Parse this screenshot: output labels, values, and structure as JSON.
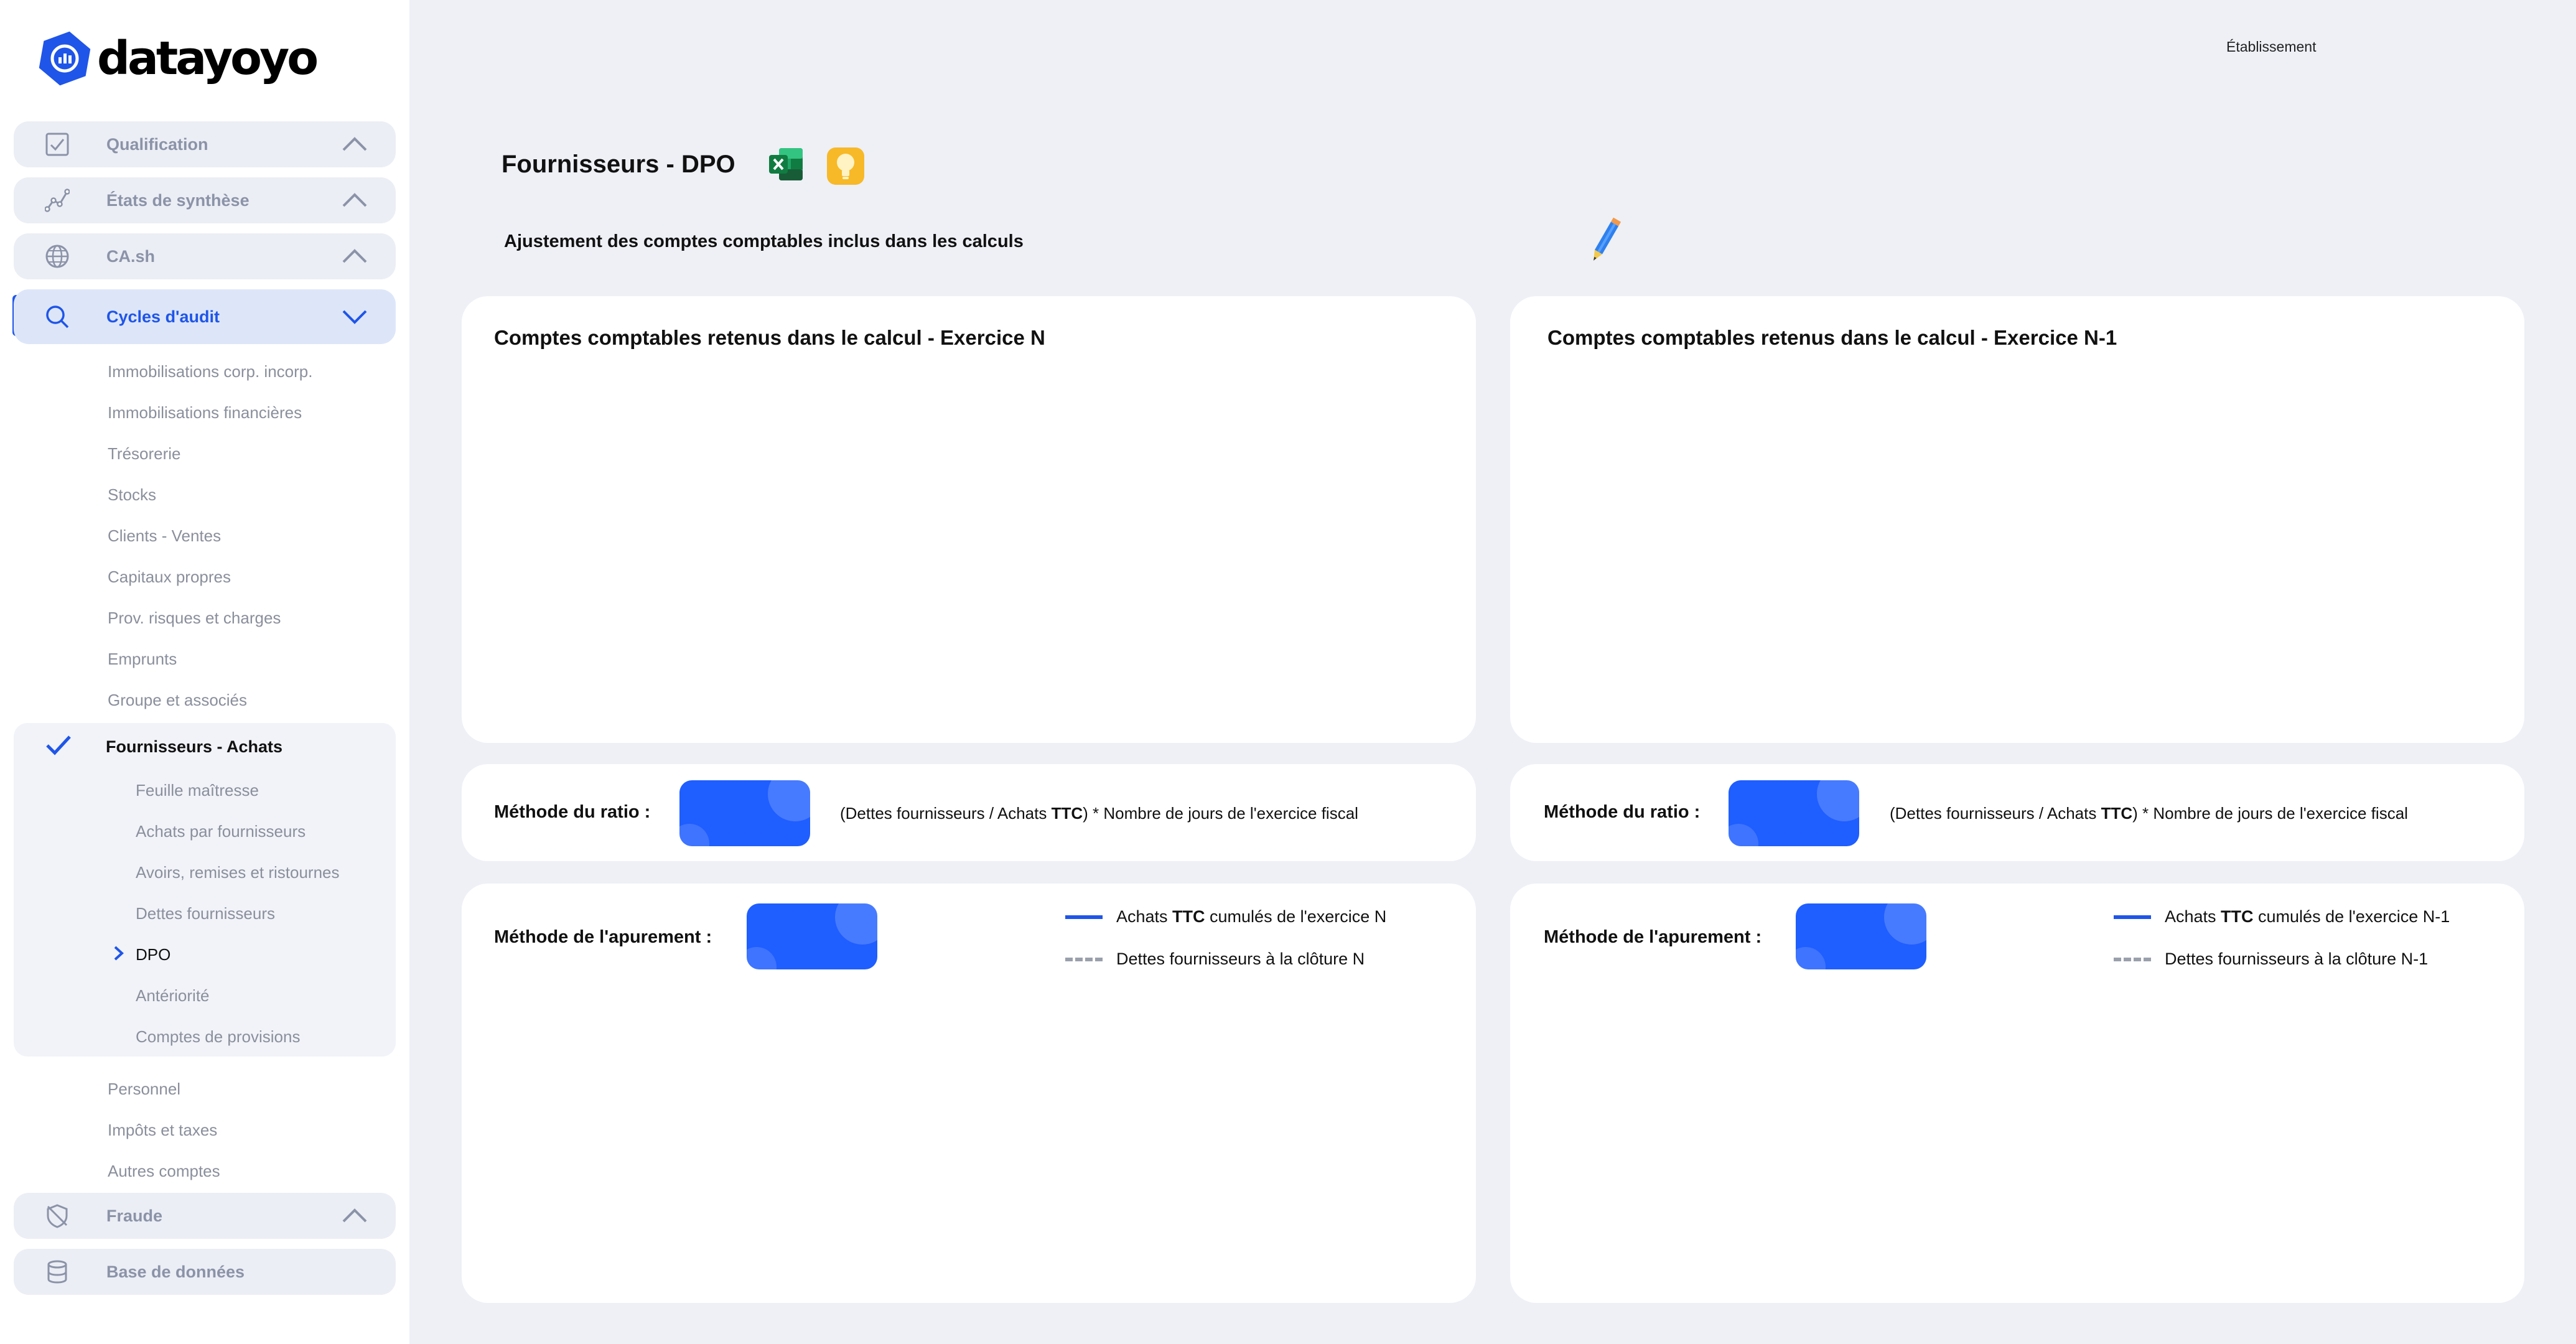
{
  "brand": {
    "name": "datayoyo",
    "color": "#1f55e8"
  },
  "sidebar": {
    "top_items": [
      {
        "label": "Qualification",
        "icon": "checkbox-icon"
      },
      {
        "label": "États de synthèse",
        "icon": "line-chart-icon"
      },
      {
        "label": "CA.sh",
        "icon": "globe-icon"
      }
    ],
    "active_item": {
      "label": "Cycles d'audit",
      "icon": "search-icon"
    },
    "cycles": [
      "Immobilisations corp. incorp.",
      "Immobilisations financières",
      "Trésorerie",
      "Stocks",
      "Clients - Ventes",
      "Capitaux propres",
      "Prov. risques et charges",
      "Emprunts",
      "Groupe et associés"
    ],
    "group": {
      "title": "Fournisseurs - Achats",
      "items": [
        "Feuille maîtresse",
        "Achats par fournisseurs",
        "Avoirs, remises et ristournes",
        "Dettes fournisseurs",
        "DPO",
        "Antériorité",
        "Comptes de provisions"
      ]
    },
    "after_group": [
      "Personnel",
      "Impôts et taxes",
      "Autres comptes"
    ],
    "bottom_items": [
      {
        "label": "Fraude",
        "icon": "shield-off-icon"
      },
      {
        "label": "Base de données",
        "icon": "database-icon"
      }
    ]
  },
  "header": {
    "establishment": "Établissement"
  },
  "page": {
    "title": "Fournisseurs - DPO",
    "subtitle": "Ajustement des comptes comptables inclus dans les calculs"
  },
  "cards": {
    "accounts_n_title": "Comptes comptables retenus dans le calcul - Exercice N",
    "accounts_n1_title": "Comptes comptables retenus dans le calcul - Exercice N-1",
    "ratio_label": "Méthode du ratio :",
    "ratio_formula_pre": "(Dettes fournisseurs / Achats ",
    "ratio_formula_bold": "TTC",
    "ratio_formula_post": ") * Nombre de jours de l'exercice fiscal",
    "apurement_label": "Méthode de l'apurement :",
    "legend_n": {
      "purchases_pre": "Achats ",
      "purchases_bold": "TTC",
      "purchases_post": " cumulés de l'exercice N",
      "debts": "Dettes fournisseurs à la clôture N"
    },
    "legend_n1": {
      "purchases_pre": "Achats ",
      "purchases_bold": "TTC",
      "purchases_post": " cumulés de l'exercice N-1",
      "debts": "Dettes fournisseurs à la clôture N-1"
    }
  }
}
